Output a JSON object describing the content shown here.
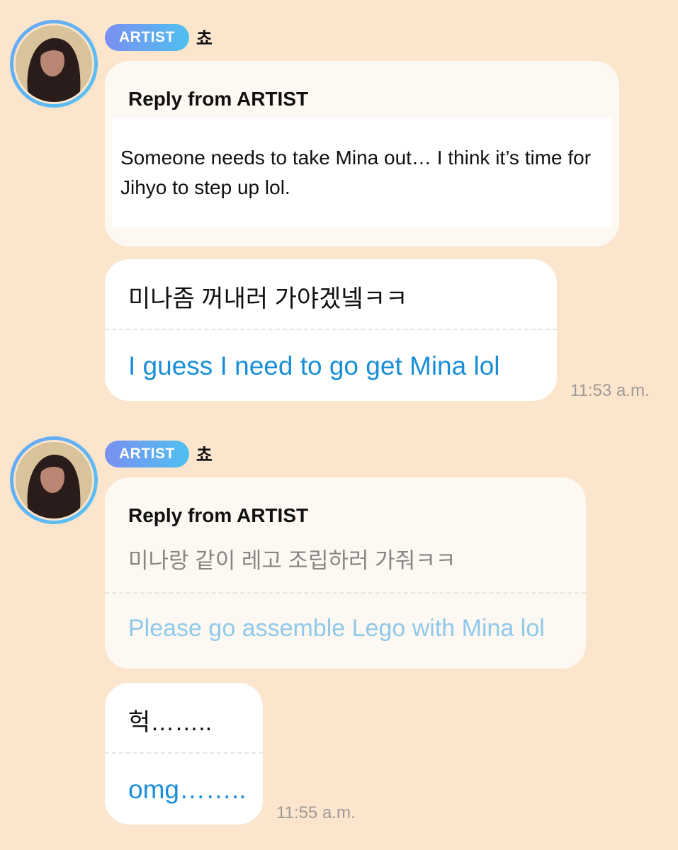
{
  "messages": [
    {
      "badge": "ARTIST",
      "sender": "쵸",
      "reply_title": "Reply from ARTIST",
      "quoted_text": "Someone needs to take Mina out… I think it’s time for Jihyo to step up lol.",
      "korean": "미나좀 꺼내러 가야겠넼ㅋㅋ",
      "english": "I guess I need to go get Mina lol",
      "time": "11:53 a.m."
    },
    {
      "badge": "ARTIST",
      "sender": "쵸",
      "reply_title": "Reply from ARTIST",
      "quoted_korean": "미나랑 같이 레고 조립하러 가줘ㅋㅋ",
      "quoted_english": "Please go assemble Lego with Mina lol",
      "korean": "헉……..",
      "english": "omg……..",
      "time": "11:55 a.m."
    }
  ],
  "colors": {
    "background": "#fbe5cc",
    "translation": "#1a8fd8",
    "badge_gradient_start": "#7a8ff2",
    "badge_gradient_end": "#4fc0f0",
    "timestamp": "#9f9a97"
  },
  "icons": {
    "avatar": "artist-avatar-photo"
  }
}
